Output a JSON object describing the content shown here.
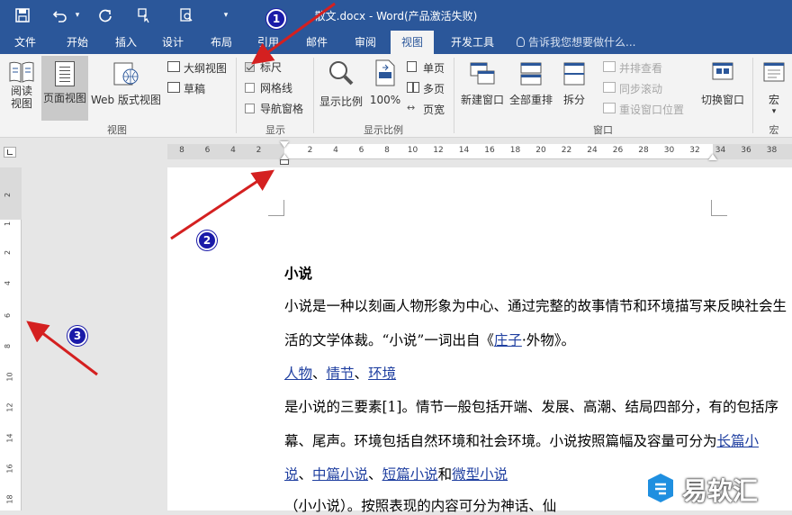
{
  "titlebar": {
    "title": "散文.docx - Word(产品激活失败)",
    "qat_dropdown": "▾"
  },
  "tabs": [
    {
      "label": "文件"
    },
    {
      "label": "开始"
    },
    {
      "label": "插入"
    },
    {
      "label": "设计"
    },
    {
      "label": "布局"
    },
    {
      "label": "引用"
    },
    {
      "label": "邮件"
    },
    {
      "label": "审阅"
    },
    {
      "label": "视图",
      "active": true
    },
    {
      "label": "开发工具"
    }
  ],
  "tellme": "告诉我您想要做什么...",
  "ribbon": {
    "views": {
      "read": "阅读\n视图",
      "print": "页面视图",
      "web": "Web 版式视图",
      "outline": "大纲视图",
      "draft": "草稿",
      "group": "视图"
    },
    "show": {
      "ruler": "标尺",
      "gridlines": "网格线",
      "navpane": "导航窗格",
      "group": "显示",
      "ruler_checked": true,
      "gridlines_checked": false,
      "navpane_checked": false
    },
    "zoom": {
      "zoom": "显示比例",
      "pct": "100%",
      "one": "单页",
      "multi": "多页",
      "width": "页宽",
      "group": "显示比例"
    },
    "window": {
      "new": "新建窗口",
      "arrange": "全部重排",
      "split": "拆分",
      "side": "并排查看",
      "sync": "同步滚动",
      "reset": "重设窗口位置",
      "switch": "切换窗口",
      "group": "窗口"
    },
    "macros": {
      "label": "宏",
      "group": "宏",
      "arrow": "▾"
    }
  },
  "ruler_numbers": [
    "8",
    "6",
    "4",
    "2",
    "2",
    "4",
    "6",
    "8",
    "10",
    "12",
    "14",
    "16",
    "18",
    "20",
    "22",
    "24",
    "26",
    "28",
    "30",
    "32",
    "34",
    "36",
    "38"
  ],
  "vruler_numbers": [
    "2",
    "1",
    "2",
    "4",
    "6",
    "8",
    "10",
    "12",
    "14",
    "16",
    "18"
  ],
  "doc": {
    "heading": "小说",
    "p1a": "小说是一种以刻画人物形象为中心、通过完整的故事情节和环境描写来反映社会生",
    "p1b_pre": "活的文学体裁。“小说”一词出自《",
    "p1b_link": "庄子",
    "p1b_post": "·外物》。",
    "l1": "人物",
    "sepA": "、",
    "l2": "情节",
    "sepB": "、",
    "l3": "环境",
    "p2a": "是小说的三要素[1]。情节一般包括开端、发展、高潮、结局四部分，有的包括序",
    "p2b_pre": "幕、尾声。环境包括自然环境和社会环境。小说按照篇幅及容量可分为",
    "p2b_link": "长篇小",
    "p3_l1": "说",
    "p3_s1": "、",
    "p3_l2": "中篇小说",
    "p3_s2": "、",
    "p3_l3": "短篇小说",
    "p3_s3": "和",
    "p3_l4": "微型小说",
    "p4": "（小小说）。按照表现的内容可分为神话、仙"
  },
  "badges": [
    "1",
    "2",
    "3"
  ],
  "watermark": {
    "text": "易软汇"
  },
  "colors": {
    "accent": "#2b579a",
    "annotation": "#d42020",
    "badge": "#1a1aa8"
  }
}
